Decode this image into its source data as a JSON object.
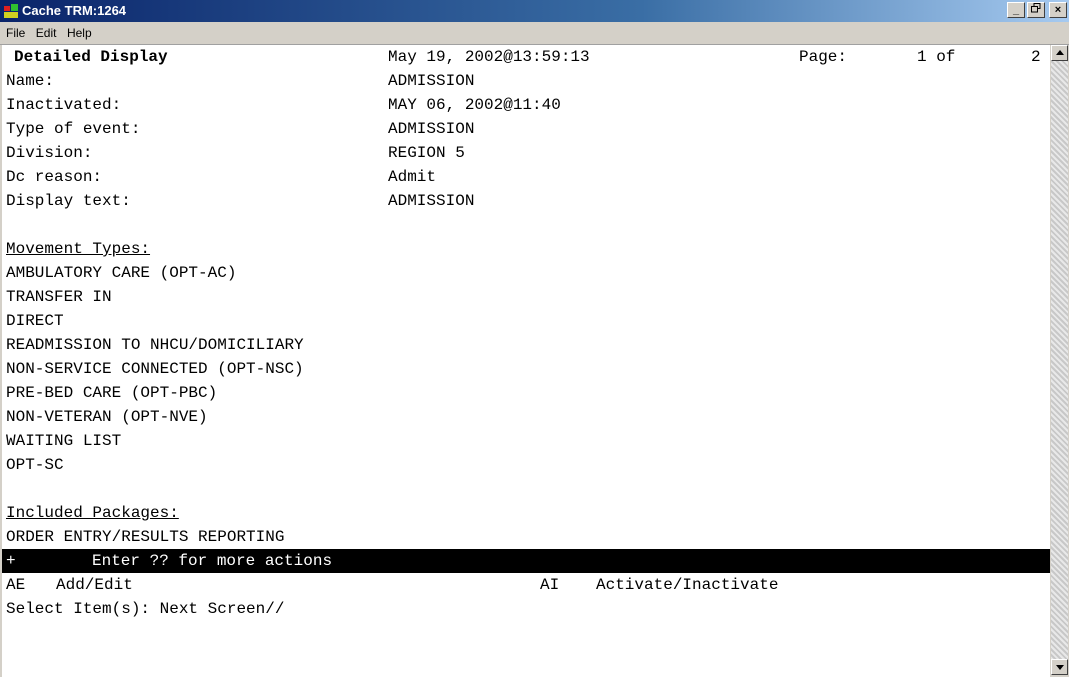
{
  "window": {
    "title": "Cache TRM:1264"
  },
  "menu": [
    "File",
    "Edit",
    "Help"
  ],
  "header": {
    "screen_title": "Detailed Display",
    "datetime": "May 19, 2002@13:59:13",
    "page_label": "Page:",
    "page_current": "1 of",
    "page_total": "2"
  },
  "fields": [
    {
      "label": "Name:",
      "value": "ADMISSION"
    },
    {
      "label": "Inactivated:",
      "value": "MAY 06, 2002@11:40"
    },
    {
      "label": "Type of event:",
      "value": "ADMISSION"
    },
    {
      "label": "Division:",
      "value": "REGION 5"
    },
    {
      "label": "Dc reason:",
      "value": "Admit"
    },
    {
      "label": "Display text:",
      "value": "ADMISSION"
    }
  ],
  "movement": {
    "heading": "Movement Types:",
    "items": [
      "AMBULATORY CARE (OPT-AC)",
      "TRANSFER IN",
      "DIRECT",
      "READMISSION TO NHCU/DOMICILIARY",
      "NON-SERVICE CONNECTED (OPT-NSC)",
      "PRE-BED CARE (OPT-PBC)",
      "NON-VETERAN (OPT-NVE)",
      "WAITING LIST",
      "OPT-SC"
    ]
  },
  "packages": {
    "heading": "Included Packages:",
    "items": [
      "ORDER ENTRY/RESULTS REPORTING"
    ]
  },
  "action_bar": {
    "plus": "+",
    "text": "Enter ?? for more actions"
  },
  "actions": [
    {
      "code": "AE",
      "label": "Add/Edit"
    },
    {
      "code": "AI",
      "label": "Activate/Inactivate"
    }
  ],
  "prompt": "Select Item(s): Next Screen//"
}
